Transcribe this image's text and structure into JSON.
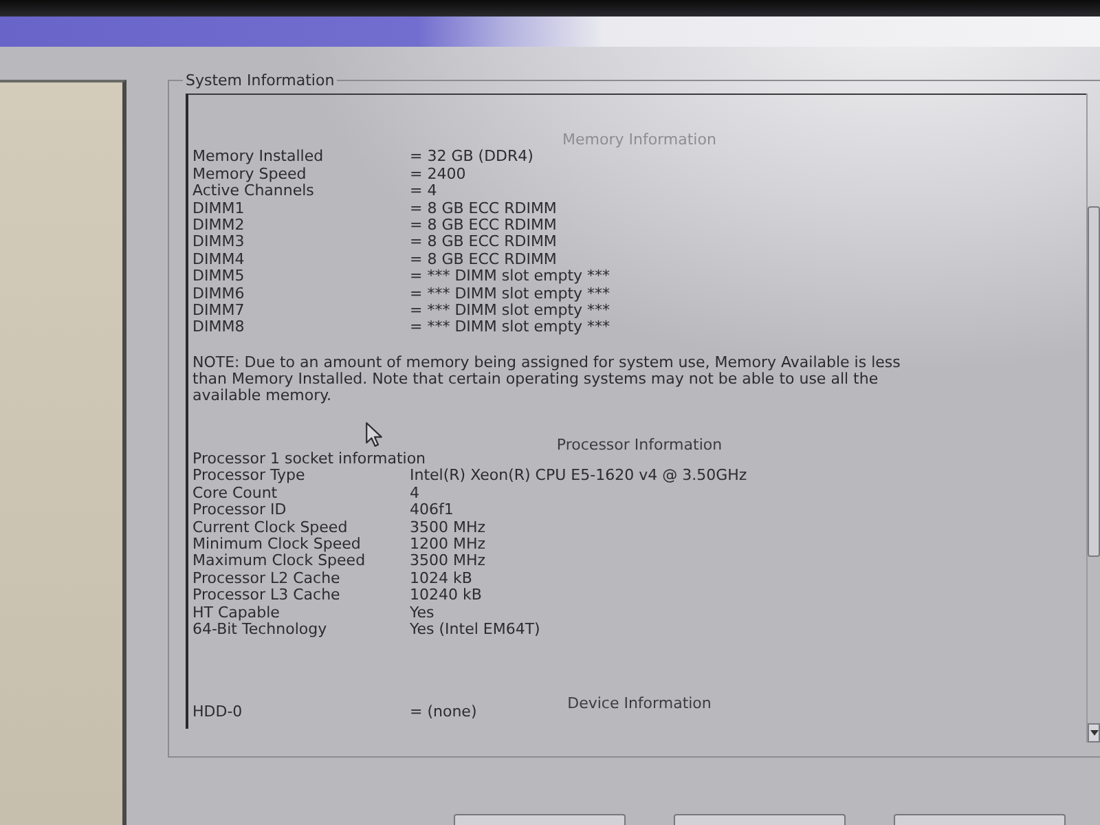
{
  "group_box": {
    "title": "System Information"
  },
  "sections": [
    {
      "heading": "Memory Information",
      "rows": [
        {
          "label": "Memory Installed",
          "value": "= 32 GB (DDR4)"
        },
        {
          "label": "Memory Speed",
          "value": "= 2400"
        },
        {
          "label": "Active Channels",
          "value": "= 4"
        },
        {
          "label": "DIMM1",
          "value": "= 8 GB ECC RDIMM"
        },
        {
          "label": "DIMM2",
          "value": "= 8 GB ECC RDIMM"
        },
        {
          "label": "DIMM3",
          "value": "= 8 GB ECC RDIMM"
        },
        {
          "label": "DIMM4",
          "value": "= 8 GB ECC RDIMM"
        },
        {
          "label": "DIMM5",
          "value": "= *** DIMM slot empty ***"
        },
        {
          "label": "DIMM6",
          "value": "= *** DIMM slot empty ***"
        },
        {
          "label": "DIMM7",
          "value": "= *** DIMM slot empty ***"
        },
        {
          "label": "DIMM8",
          "value": "= *** DIMM slot empty ***"
        }
      ],
      "note": "NOTE: Due to an amount of memory being assigned for system use, Memory Available is less than Memory Installed. Note that certain operating systems may not be able to use all the available memory."
    },
    {
      "heading": "Processor Information",
      "subheading": "Processor 1 socket information",
      "rows": [
        {
          "label": "Processor Type",
          "value": "Intel(R) Xeon(R) CPU E5-1620 v4 @ 3.50GHz"
        },
        {
          "label": "Core Count",
          "value": "4"
        },
        {
          "label": "Processor ID",
          "value": "406f1"
        },
        {
          "label": "Current Clock Speed",
          "value": "3500 MHz"
        },
        {
          "label": "Minimum Clock Speed",
          "value": "1200 MHz"
        },
        {
          "label": "Maximum Clock Speed",
          "value": "3500 MHz"
        },
        {
          "label": "Processor L2 Cache",
          "value": "1024 kB"
        },
        {
          "label": "Processor L3 Cache",
          "value": "10240 kB"
        },
        {
          "label": "HT Capable",
          "value": "Yes"
        },
        {
          "label": "64-Bit Technology",
          "value": "Yes (Intel EM64T)"
        }
      ]
    },
    {
      "heading": "Device Information",
      "rows": [
        {
          "label": "HDD-0",
          "value": "= (none)"
        }
      ]
    }
  ]
}
